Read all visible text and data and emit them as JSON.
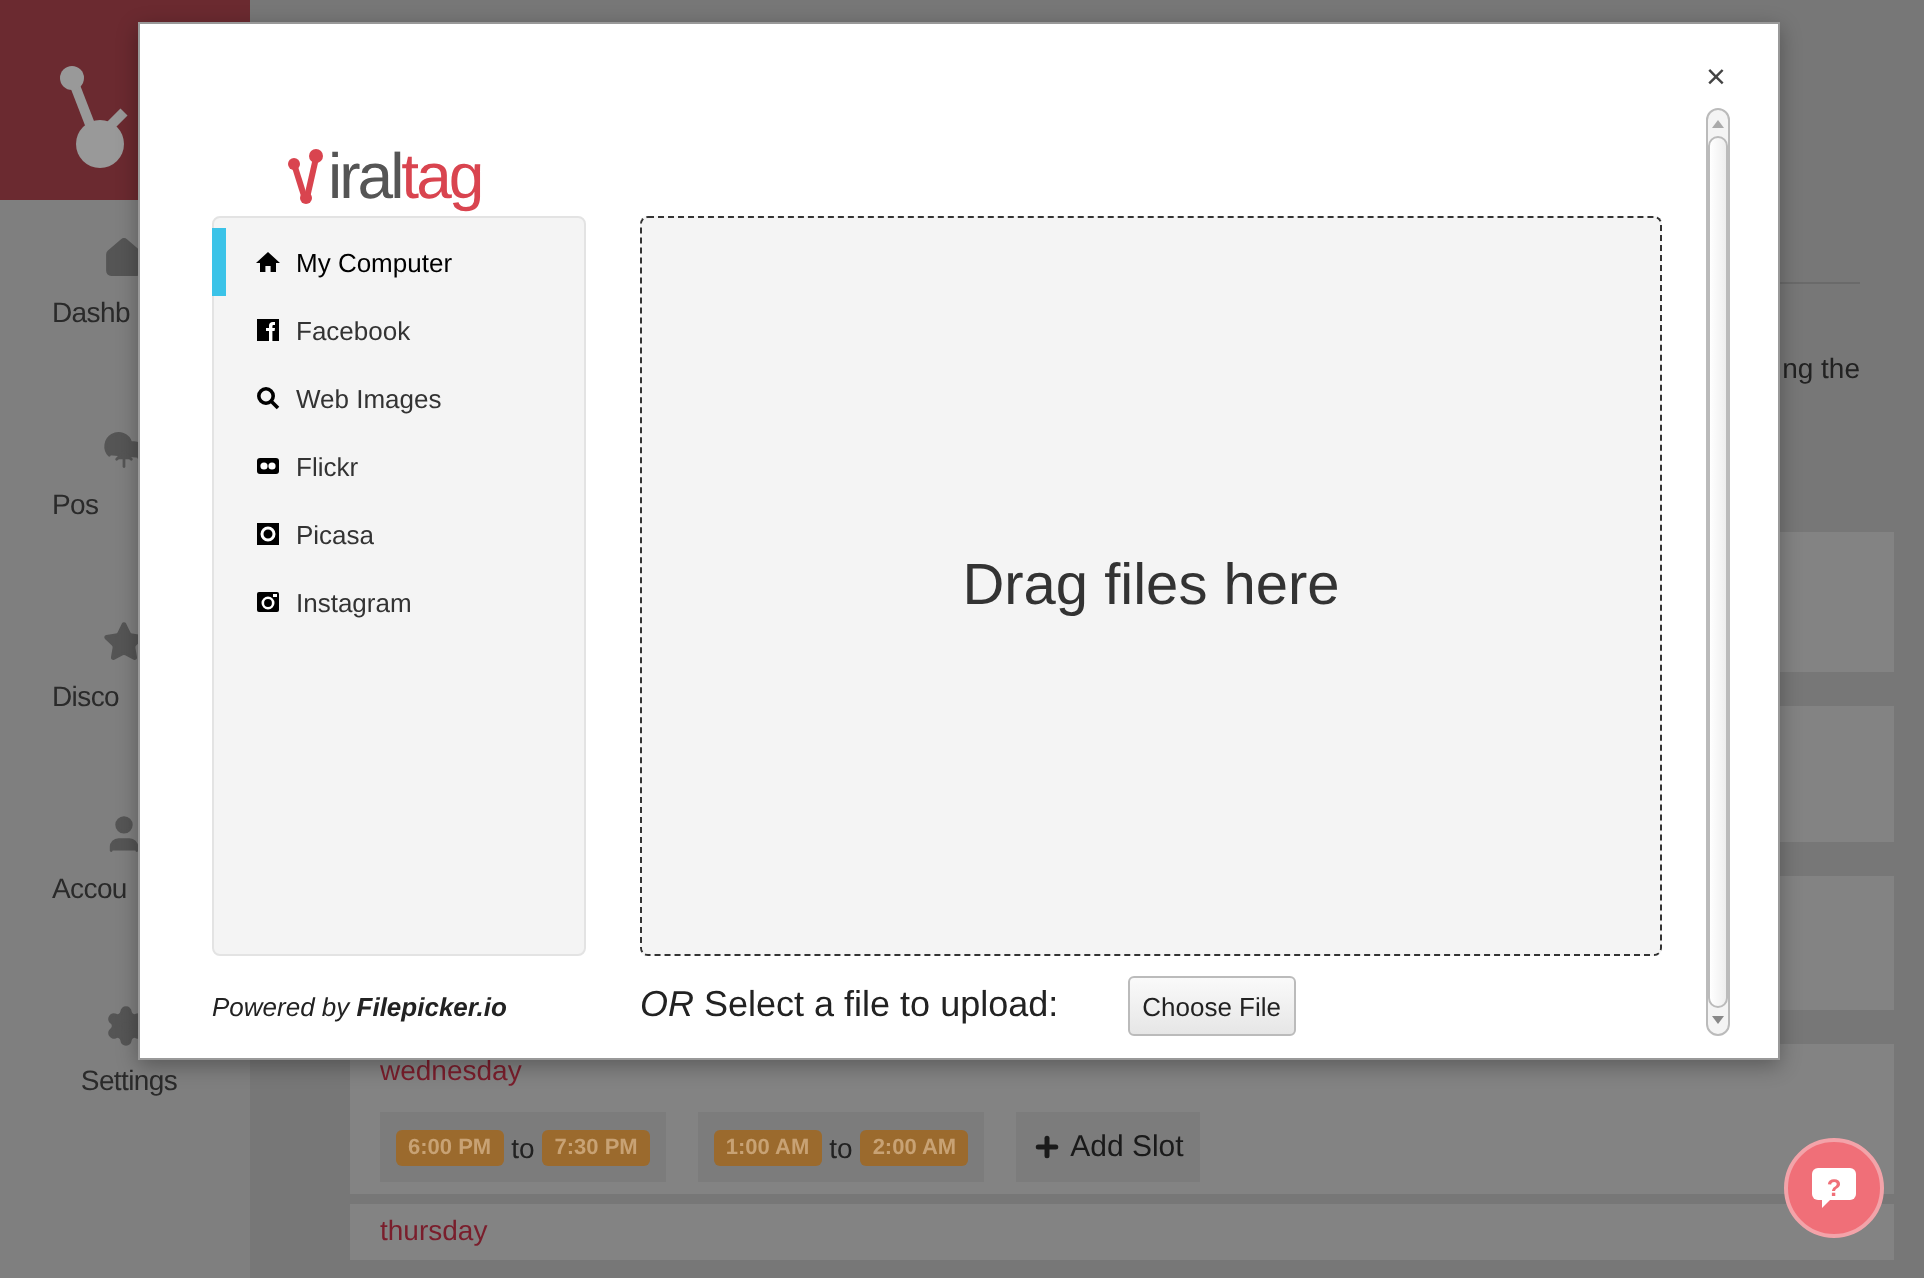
{
  "sidebar": {
    "items": [
      {
        "label": "Dashb"
      },
      {
        "label": "Pos"
      },
      {
        "label": "Disco"
      },
      {
        "label": "Accou"
      },
      {
        "label": "Settings"
      }
    ]
  },
  "page": {
    "text_fragment": "ng the",
    "days": [
      {
        "name": "wednesday",
        "slots": [
          {
            "start": "6:00 PM",
            "separator": "to",
            "end": "7:30 PM"
          },
          {
            "start": "1:00 AM",
            "separator": "to",
            "end": "2:00 AM"
          }
        ],
        "add_button": "Add Slot"
      },
      {
        "name": "thursday"
      }
    ]
  },
  "modal": {
    "close": "×",
    "logo": {
      "part_1": "iral",
      "part_2": "tag"
    },
    "sources": [
      {
        "label": "My Computer",
        "selected": true
      },
      {
        "label": "Facebook",
        "selected": false
      },
      {
        "label": "Web Images",
        "selected": false
      },
      {
        "label": "Flickr",
        "selected": false
      },
      {
        "label": "Picasa",
        "selected": false
      },
      {
        "label": "Instagram",
        "selected": false
      }
    ],
    "drop_zone": "Drag files here",
    "powered_by": "Powered by **Filepicker.io**",
    "upload_prompt": "*OR* Select a file to upload:",
    "choose_button": "Choose File"
  },
  "help_button": "?"
}
